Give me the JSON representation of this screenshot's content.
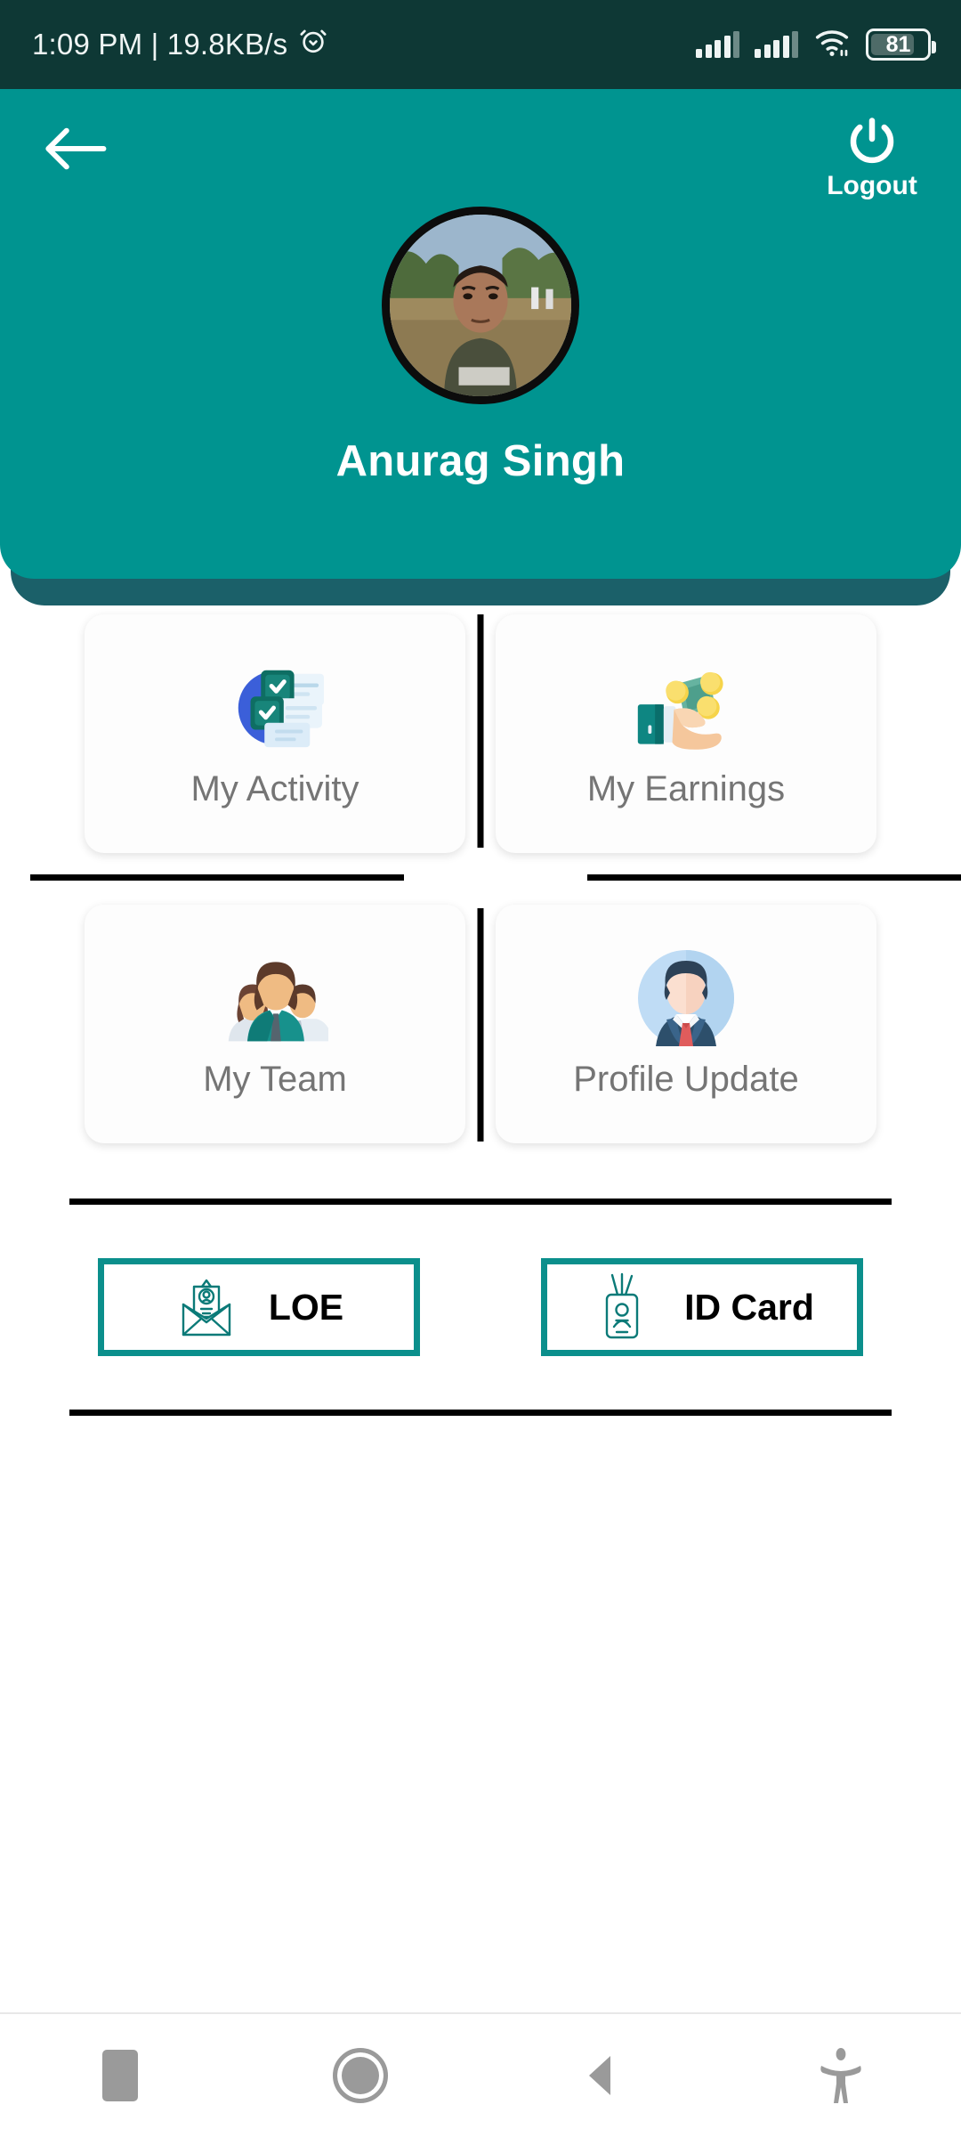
{
  "status_bar": {
    "time_and_speed": "1:09 PM | 19.8KB/s",
    "alarm_icon": "alarm-clock-icon",
    "signal_1_icon": "cellular-signal-icon",
    "signal_2_icon": "cellular-signal-icon",
    "wifi_icon": "wifi-icon",
    "battery_level": "81",
    "background_color": "#0e3835"
  },
  "header": {
    "back_icon": "back-arrow-icon",
    "logout_icon": "power-icon",
    "logout_label": "Logout",
    "avatar_name": "profile-photo",
    "user_name": "Anurag Singh",
    "background_color": "#009490",
    "shadow_color": "#1b6069"
  },
  "menu": {
    "tiles": [
      {
        "label": "My Activity",
        "icon": "activity-checklist-icon"
      },
      {
        "label": "My Earnings",
        "icon": "hand-money-coins-icon"
      },
      {
        "label": "My Team",
        "icon": "team-people-icon"
      },
      {
        "label": "Profile Update",
        "icon": "businessman-avatar-icon"
      }
    ]
  },
  "documents": {
    "buttons": [
      {
        "label": "LOE",
        "icon": "envelope-certificate-icon"
      },
      {
        "label": "ID Card",
        "icon": "id-badge-icon"
      }
    ],
    "border_color": "#0b8f8c"
  },
  "nav_bar": {
    "items": [
      {
        "name": "recents-button",
        "icon": "square-icon"
      },
      {
        "name": "home-button",
        "icon": "circle-icon"
      },
      {
        "name": "back-button",
        "icon": "triangle-left-icon"
      },
      {
        "name": "accessibility-button",
        "icon": "accessibility-icon"
      }
    ]
  },
  "colors": {
    "accent_teal": "#009490",
    "status_bar": "#0e3835",
    "label_gray": "#757575",
    "divider_black": "#000000"
  }
}
